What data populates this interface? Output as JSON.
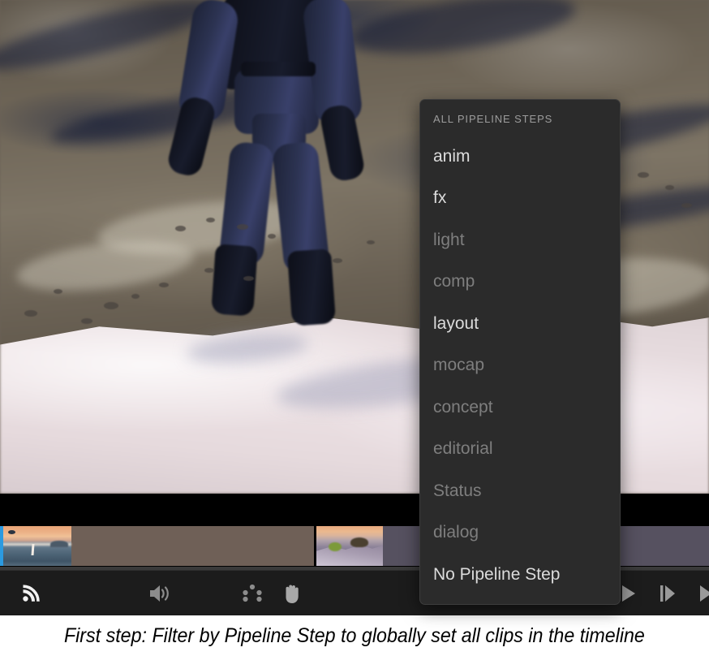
{
  "app": {
    "viewport": {
      "description": "3D animated character in dark blue armor standing on snow in front of a rocky cliff"
    }
  },
  "menu": {
    "header": "ALL PIPELINE STEPS",
    "items": [
      {
        "label": "anim",
        "enabled": true
      },
      {
        "label": "fx",
        "enabled": true
      },
      {
        "label": "light",
        "enabled": false
      },
      {
        "label": "comp",
        "enabled": false
      },
      {
        "label": "layout",
        "enabled": true
      },
      {
        "label": "mocap",
        "enabled": false
      },
      {
        "label": "concept",
        "enabled": false
      },
      {
        "label": "editorial",
        "enabled": false
      },
      {
        "label": "Status",
        "enabled": false
      },
      {
        "label": "dialog",
        "enabled": false
      },
      {
        "label": "No Pipeline Step",
        "enabled": true
      }
    ]
  },
  "timeline": {
    "clips": [
      {
        "name": "clip-ocean-sunset",
        "selected": true,
        "body_color": "#6f6057"
      },
      {
        "name": "clip-desert-dune",
        "selected": false,
        "body_color": "#565160"
      }
    ]
  },
  "transport": {
    "buttons": [
      {
        "name": "broadcast-icon",
        "label": "Broadcast",
        "active": true
      },
      {
        "name": "volume-icon",
        "label": "Volume",
        "active": false
      },
      {
        "name": "five-dots-icon",
        "label": "Tools",
        "active": false
      },
      {
        "name": "hand-icon",
        "label": "Pan",
        "active": true
      },
      {
        "name": "play-icon",
        "label": "Play",
        "active": false
      },
      {
        "name": "step-forward-icon",
        "label": "Step Forward",
        "active": false
      },
      {
        "name": "next-icon",
        "label": "Next",
        "active": false
      }
    ]
  },
  "caption": {
    "text": "First step: Filter by Pipeline Step to globally set all clips in the timeline"
  },
  "colors": {
    "menu_bg": "#2b2b2b",
    "menu_border": "#3d3d3d",
    "menu_header": "#9c9c9c",
    "item_enabled": "#dcdcdc",
    "item_disabled": "#7e7e7e",
    "transport_bg": "#1c1c1c",
    "selection_blue": "#2b9ae0",
    "caption_bg": "#ffffff"
  }
}
